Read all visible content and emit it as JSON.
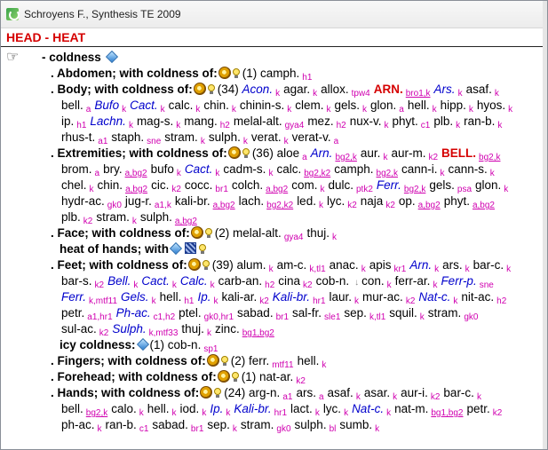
{
  "window": {
    "title": "Schroyens F., Synthesis TE 2009"
  },
  "rubric": {
    "heading": "HEAD - HEAT",
    "main": "- coldness"
  },
  "rows": [
    {
      "label": "Abdomen; with coldness of:",
      "count": "(1)",
      "lines": [
        [
          [
            "camph.",
            "r1"
          ],
          [
            "h1",
            "ab"
          ]
        ]
      ]
    },
    {
      "label": "Body; with coldness of:",
      "count": "(34)",
      "lines": [
        [
          [
            "Acon.",
            "r2"
          ],
          [
            "k",
            "ab"
          ],
          [
            "agar.",
            "r1"
          ],
          [
            "k",
            "ab"
          ],
          [
            "allox.",
            "r1"
          ],
          [
            "tpw4",
            "ab"
          ],
          [
            "ARN.",
            "r3"
          ],
          [
            "bro1,k",
            "abu"
          ],
          [
            "Ars.",
            "r2"
          ],
          [
            "k",
            "ab"
          ],
          [
            "asaf.",
            "r1"
          ],
          [
            "k",
            "ab"
          ]
        ],
        [
          [
            "bell.",
            "r1"
          ],
          [
            "a",
            "ab"
          ],
          [
            "Bufo",
            "r2"
          ],
          [
            "k",
            "ab"
          ],
          [
            "Cact.",
            "r2"
          ],
          [
            "k",
            "ab"
          ],
          [
            "calc.",
            "r1"
          ],
          [
            "k",
            "ab"
          ],
          [
            "chin.",
            "r1"
          ],
          [
            "k",
            "ab"
          ],
          [
            "chinin-s.",
            "r1"
          ],
          [
            "k",
            "ab"
          ],
          [
            "clem.",
            "r1"
          ],
          [
            "k",
            "ab"
          ],
          [
            "gels.",
            "r1"
          ],
          [
            "k",
            "ab"
          ],
          [
            "glon.",
            "r1"
          ],
          [
            "a",
            "ab"
          ],
          [
            "hell.",
            "r1"
          ],
          [
            "k",
            "ab"
          ],
          [
            "hipp.",
            "r1"
          ],
          [
            "k",
            "ab"
          ],
          [
            "hyos.",
            "r1"
          ],
          [
            "k",
            "ab"
          ]
        ],
        [
          [
            "ip.",
            "r1"
          ],
          [
            "h1",
            "ab"
          ],
          [
            "Lachn.",
            "r2"
          ],
          [
            "k",
            "ab"
          ],
          [
            "mag-s.",
            "r1"
          ],
          [
            "k",
            "ab"
          ],
          [
            "mang.",
            "r1"
          ],
          [
            "h2",
            "ab"
          ],
          [
            "melal-alt.",
            "r1"
          ],
          [
            "gya4",
            "ab"
          ],
          [
            "mez.",
            "r1"
          ],
          [
            "h2",
            "ab"
          ],
          [
            "nux-v.",
            "r1"
          ],
          [
            "k",
            "ab"
          ],
          [
            "phyt.",
            "r1"
          ],
          [
            "c1",
            "ab"
          ],
          [
            "plb.",
            "r1"
          ],
          [
            "k",
            "ab"
          ],
          [
            "ran-b.",
            "r1"
          ],
          [
            "k",
            "ab"
          ]
        ],
        [
          [
            "rhus-t.",
            "r1"
          ],
          [
            "a1",
            "ab"
          ],
          [
            "staph.",
            "r1"
          ],
          [
            "sne",
            "ab"
          ],
          [
            "stram.",
            "r1"
          ],
          [
            "k",
            "ab"
          ],
          [
            "sulph.",
            "r1"
          ],
          [
            "k",
            "ab"
          ],
          [
            "verat.",
            "r1"
          ],
          [
            "k",
            "ab"
          ],
          [
            "verat-v.",
            "r1"
          ],
          [
            "a",
            "ab"
          ]
        ]
      ]
    },
    {
      "label": "Extremities; with coldness of:",
      "count": "(36)",
      "lines": [
        [
          [
            "aloe",
            "r1"
          ],
          [
            "a",
            "ab"
          ],
          [
            "Arn.",
            "r2"
          ],
          [
            "bg2,k",
            "abu"
          ],
          [
            "aur.",
            "r1"
          ],
          [
            "k",
            "ab"
          ],
          [
            "aur-m.",
            "r1"
          ],
          [
            "k2",
            "ab"
          ],
          [
            "BELL.",
            "r3"
          ],
          [
            "bg2,k",
            "abu"
          ]
        ],
        [
          [
            "brom.",
            "r1"
          ],
          [
            "a",
            "ab"
          ],
          [
            "bry.",
            "r1"
          ],
          [
            "a,bg2",
            "abu"
          ],
          [
            "bufo",
            "r1"
          ],
          [
            "k",
            "ab"
          ],
          [
            "Cact.",
            "r2"
          ],
          [
            "k",
            "ab"
          ],
          [
            "cadm-s.",
            "r1"
          ],
          [
            "k",
            "ab"
          ],
          [
            "calc.",
            "r1"
          ],
          [
            "bg2,k2",
            "abu"
          ],
          [
            "camph.",
            "r1"
          ],
          [
            "bg2,k",
            "abu"
          ],
          [
            "cann-i.",
            "r1"
          ],
          [
            "k",
            "ab"
          ],
          [
            "cann-s.",
            "r1"
          ],
          [
            "k",
            "ab"
          ]
        ],
        [
          [
            "chel.",
            "r1"
          ],
          [
            "k",
            "ab"
          ],
          [
            "chin.",
            "r1"
          ],
          [
            "a,bg2",
            "abu"
          ],
          [
            "cic.",
            "r1"
          ],
          [
            "k2",
            "ab"
          ],
          [
            "cocc.",
            "r1"
          ],
          [
            "br1",
            "ab"
          ],
          [
            "colch.",
            "r1"
          ],
          [
            "a,bg2",
            "abu"
          ],
          [
            "com.",
            "r1"
          ],
          [
            "k",
            "ab"
          ],
          [
            "dulc.",
            "r1"
          ],
          [
            "ptk2",
            "ab"
          ],
          [
            "Ferr.",
            "r2"
          ],
          [
            "bg2,k",
            "abu"
          ],
          [
            "gels.",
            "r1"
          ],
          [
            "psa",
            "ab"
          ],
          [
            "glon.",
            "r1"
          ],
          [
            "k",
            "ab"
          ]
        ],
        [
          [
            "hydr-ac.",
            "r1"
          ],
          [
            "gk0",
            "ab"
          ],
          [
            "jug-r.",
            "r1"
          ],
          [
            "a1,k",
            "ab"
          ],
          [
            "kali-br.",
            "r1"
          ],
          [
            "a,bg2",
            "abu"
          ],
          [
            "lach.",
            "r1"
          ],
          [
            "bg2,k2",
            "abu"
          ],
          [
            "led.",
            "r1"
          ],
          [
            "k",
            "ab"
          ],
          [
            "lyc.",
            "r1"
          ],
          [
            "k2",
            "ab"
          ],
          [
            "naja",
            "r1"
          ],
          [
            "k2",
            "ab"
          ],
          [
            "op.",
            "r1"
          ],
          [
            "a,bg2",
            "abu"
          ],
          [
            "phyt.",
            "r1"
          ],
          [
            "a,bg2",
            "abu"
          ]
        ],
        [
          [
            "plb.",
            "r1"
          ],
          [
            "k2",
            "ab"
          ],
          [
            "stram.",
            "r1"
          ],
          [
            "k",
            "ab"
          ],
          [
            "sulph.",
            "r1"
          ],
          [
            "a,bg2",
            "abu"
          ]
        ]
      ]
    },
    {
      "label": "Face; with coldness of:",
      "count": "(2)",
      "lines": [
        [
          [
            "melal-alt.",
            "r1"
          ],
          [
            "gya4",
            "ab"
          ],
          [
            "thuj.",
            "r1"
          ],
          [
            "k",
            "ab"
          ]
        ]
      ]
    },
    {
      "label": "heat of hands; with",
      "count": "",
      "lines": []
    },
    {
      "label": "Feet; with coldness of:",
      "count": "(39)",
      "lines": [
        [
          [
            "alum.",
            "r1"
          ],
          [
            "k",
            "ab"
          ],
          [
            "am-c.",
            "r1"
          ],
          [
            "k,tl1",
            "ab"
          ],
          [
            "anac.",
            "r1"
          ],
          [
            "k",
            "ab"
          ],
          [
            "apis",
            "r1"
          ],
          [
            "kr1",
            "ab"
          ],
          [
            "Arn.",
            "r2"
          ],
          [
            "k",
            "ab"
          ],
          [
            "ars.",
            "r1"
          ],
          [
            "k",
            "ab"
          ],
          [
            "bar-c.",
            "r1"
          ],
          [
            "k",
            "ab"
          ]
        ],
        [
          [
            "bar-s.",
            "r1"
          ],
          [
            "k2",
            "ab"
          ],
          [
            "Bell.",
            "r2"
          ],
          [
            "k",
            "ab"
          ],
          [
            "Cact.",
            "r2"
          ],
          [
            "k",
            "ab"
          ],
          [
            "Calc.",
            "r2"
          ],
          [
            "k",
            "ab"
          ],
          [
            "carb-an.",
            "r1"
          ],
          [
            "h2",
            "ab"
          ],
          [
            "cina",
            "r1"
          ],
          [
            "k2",
            "ab"
          ],
          [
            "cob-n.",
            "r1"
          ],
          [
            "↓",
            "sm"
          ],
          [
            "con.",
            "r1"
          ],
          [
            "k",
            "ab"
          ],
          [
            "ferr-ar.",
            "r1"
          ],
          [
            "k",
            "ab"
          ],
          [
            "Ferr-p.",
            "r2"
          ],
          [
            "sne",
            "ab"
          ]
        ],
        [
          [
            "Ferr.",
            "r2"
          ],
          [
            "k,mtf11",
            "ab"
          ],
          [
            "Gels.",
            "r2"
          ],
          [
            "k",
            "ab"
          ],
          [
            "hell.",
            "r1"
          ],
          [
            "h1",
            "ab"
          ],
          [
            "Ip.",
            "r2"
          ],
          [
            "k",
            "ab"
          ],
          [
            "kali-ar.",
            "r1"
          ],
          [
            "k2",
            "ab"
          ],
          [
            "Kali-br.",
            "r2"
          ],
          [
            "hr1",
            "ab"
          ],
          [
            "laur.",
            "r1"
          ],
          [
            "k",
            "ab"
          ],
          [
            "mur-ac.",
            "r1"
          ],
          [
            "k2",
            "ab"
          ],
          [
            "Nat-c.",
            "r2"
          ],
          [
            "k",
            "ab"
          ],
          [
            "nit-ac.",
            "r1"
          ],
          [
            "h2",
            "ab"
          ]
        ],
        [
          [
            "petr.",
            "r1"
          ],
          [
            "a1,hr1",
            "ab"
          ],
          [
            "Ph-ac.",
            "r2"
          ],
          [
            "c1,h2",
            "ab"
          ],
          [
            "ptel.",
            "r1"
          ],
          [
            "gk0,hr1",
            "ab"
          ],
          [
            "sabad.",
            "r1"
          ],
          [
            "br1",
            "ab"
          ],
          [
            "sal-fr.",
            "r1"
          ],
          [
            "sle1",
            "ab"
          ],
          [
            "sep.",
            "r1"
          ],
          [
            "k,tl1",
            "ab"
          ],
          [
            "squil.",
            "r1"
          ],
          [
            "k",
            "ab"
          ],
          [
            "stram.",
            "r1"
          ],
          [
            "gk0",
            "ab"
          ]
        ],
        [
          [
            "sul-ac.",
            "r1"
          ],
          [
            "k2",
            "ab"
          ],
          [
            "Sulph.",
            "r2"
          ],
          [
            "k,mtf33",
            "ab"
          ],
          [
            "thuj.",
            "r1"
          ],
          [
            "k",
            "ab"
          ],
          [
            "zinc.",
            "r1"
          ],
          [
            "bg1,bg2",
            "abu"
          ]
        ]
      ]
    },
    {
      "label": "icy coldness:",
      "count": "(1)",
      "lines": [
        [
          [
            "cob-n.",
            "r1"
          ],
          [
            "sp1",
            "ab"
          ]
        ]
      ]
    },
    {
      "label": "Fingers; with coldness of:",
      "count": "(2)",
      "lines": [
        [
          [
            "ferr.",
            "r1"
          ],
          [
            "mtf11",
            "ab"
          ],
          [
            "hell.",
            "r1"
          ],
          [
            "k",
            "ab"
          ]
        ]
      ]
    },
    {
      "label": "Forehead; with coldness of:",
      "count": "(1)",
      "lines": [
        [
          [
            "nat-ar.",
            "r1"
          ],
          [
            "k2",
            "ab"
          ]
        ]
      ]
    },
    {
      "label": "Hands; with coldness of:",
      "count": "(24)",
      "lines": [
        [
          [
            "arg-n.",
            "r1"
          ],
          [
            "a1",
            "ab"
          ],
          [
            "ars.",
            "r1"
          ],
          [
            "a",
            "ab"
          ],
          [
            "asaf.",
            "r1"
          ],
          [
            "k",
            "ab"
          ],
          [
            "asar.",
            "r1"
          ],
          [
            "k",
            "ab"
          ],
          [
            "aur-i.",
            "r1"
          ],
          [
            "k2",
            "ab"
          ],
          [
            "bar-c.",
            "r1"
          ],
          [
            "k",
            "ab"
          ]
        ],
        [
          [
            "bell.",
            "r1"
          ],
          [
            "bg2,k",
            "abu"
          ],
          [
            "calo.",
            "r1"
          ],
          [
            "k",
            "ab"
          ],
          [
            "hell.",
            "r1"
          ],
          [
            "k",
            "ab"
          ],
          [
            "iod.",
            "r1"
          ],
          [
            "k",
            "ab"
          ],
          [
            "Ip.",
            "r2"
          ],
          [
            "k",
            "ab"
          ],
          [
            "Kali-br.",
            "r2"
          ],
          [
            "hr1",
            "ab"
          ],
          [
            "lact.",
            "r1"
          ],
          [
            "k",
            "ab"
          ],
          [
            "lyc.",
            "r1"
          ],
          [
            "k",
            "ab"
          ],
          [
            "Nat-c.",
            "r2"
          ],
          [
            "k",
            "ab"
          ],
          [
            "nat-m.",
            "r1"
          ],
          [
            "bg1,bg2",
            "abu"
          ],
          [
            "petr.",
            "r1"
          ],
          [
            "k2",
            "ab"
          ]
        ],
        [
          [
            "ph-ac.",
            "r1"
          ],
          [
            "k",
            "ab"
          ],
          [
            "ran-b.",
            "r1"
          ],
          [
            "c1",
            "ab"
          ],
          [
            "sabad.",
            "r1"
          ],
          [
            "br1",
            "ab"
          ],
          [
            "sep.",
            "r1"
          ],
          [
            "k",
            "ab"
          ],
          [
            "stram.",
            "r1"
          ],
          [
            "gk0",
            "ab"
          ],
          [
            "sulph.",
            "r1"
          ],
          [
            "bl",
            "ab"
          ],
          [
            "sumb.",
            "r1"
          ],
          [
            "k",
            "ab"
          ]
        ]
      ]
    }
  ]
}
